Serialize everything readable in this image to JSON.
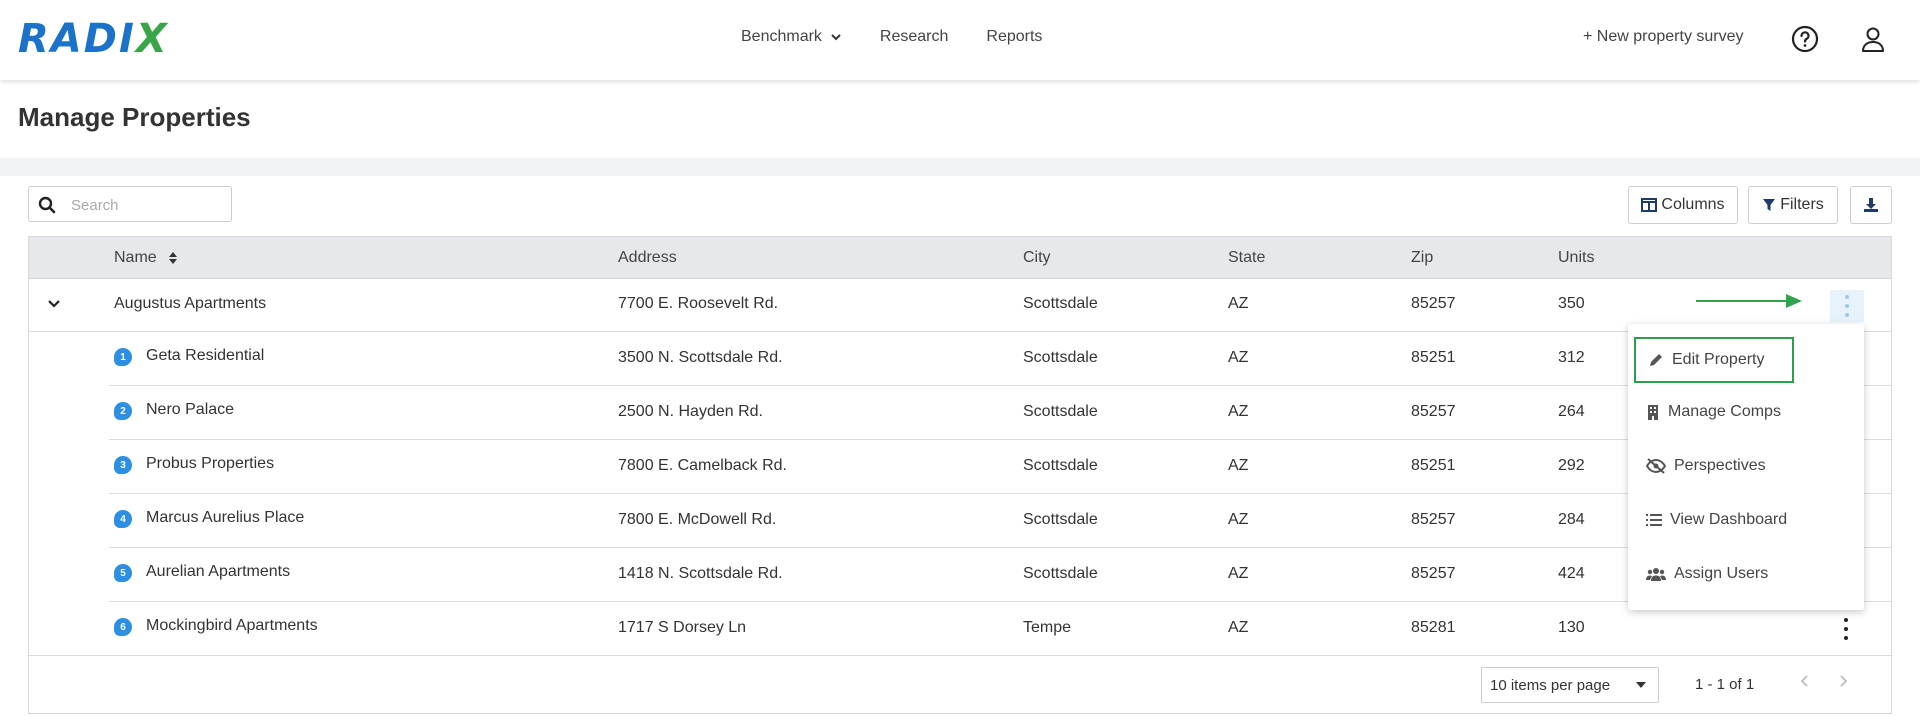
{
  "header": {
    "logo_text": "RADI",
    "logo_x": "X",
    "nav": [
      {
        "label": "Benchmark",
        "has_dropdown": true
      },
      {
        "label": "Research"
      },
      {
        "label": "Reports"
      }
    ],
    "new_survey": "+ New property survey",
    "icons": [
      "help-circle-icon",
      "user-icon"
    ]
  },
  "page": {
    "title": "Manage Properties"
  },
  "toolbar": {
    "search_placeholder": "Search",
    "columns_label": "Columns",
    "filters_label": "Filters",
    "download_icon": "download-icon"
  },
  "table": {
    "columns": [
      "Name",
      "Address",
      "City",
      "State",
      "Zip",
      "Units"
    ],
    "sort": {
      "column": "Name",
      "direction": "asc"
    },
    "parent": {
      "name": "Augustus Apartments",
      "address": "7700 E. Roosevelt Rd.",
      "city": "Scottsdale",
      "state": "AZ",
      "zip": "85257",
      "units": "350"
    },
    "rows": [
      {
        "badge": "1",
        "name": "Geta Residential",
        "address": "3500 N. Scottsdale Rd.",
        "city": "Scottsdale",
        "state": "AZ",
        "zip": "85251",
        "units": "312"
      },
      {
        "badge": "2",
        "name": "Nero Palace",
        "address": "2500 N. Hayden Rd.",
        "city": "Scottsdale",
        "state": "AZ",
        "zip": "85257",
        "units": "264"
      },
      {
        "badge": "3",
        "name": "Probus Properties",
        "address": "7800 E. Camelback Rd.",
        "city": "Scottsdale",
        "state": "AZ",
        "zip": "85251",
        "units": "292"
      },
      {
        "badge": "4",
        "name": "Marcus Aurelius Place",
        "address": "7800 E. McDowell Rd.",
        "city": "Scottsdale",
        "state": "AZ",
        "zip": "85257",
        "units": "284"
      },
      {
        "badge": "5",
        "name": "Aurelian Apartments",
        "address": "1418 N. Scottsdale Rd.",
        "city": "Scottsdale",
        "state": "AZ",
        "zip": "85257",
        "units": "424"
      },
      {
        "badge": "6",
        "name": "Mockingbird Apartments",
        "address": "1717 S Dorsey Ln",
        "city": "Tempe",
        "state": "AZ",
        "zip": "85281",
        "units": "130"
      }
    ],
    "footer": {
      "per_page": "10 items per page",
      "page_info": "1 - 1 of 1",
      "prev_icon": "chevron-left-icon",
      "next_icon": "chevron-right-icon"
    }
  },
  "row_menu": {
    "items": [
      {
        "label": "Edit Property",
        "icon": "pencil-icon",
        "highlighted": true
      },
      {
        "label": "Manage Comps",
        "icon": "building-icon"
      },
      {
        "label": "Perspectives",
        "icon": "eye-slash-icon"
      },
      {
        "label": "View Dashboard",
        "icon": "list-icon"
      },
      {
        "label": "Assign Users",
        "icon": "users-icon"
      }
    ]
  },
  "colors": {
    "brand_blue": "#1a73c9",
    "brand_green": "#3aa548",
    "badge_blue": "#2c8fe3",
    "highlight_green": "#2e9e4e",
    "header_gray": "#e6e8eb"
  }
}
